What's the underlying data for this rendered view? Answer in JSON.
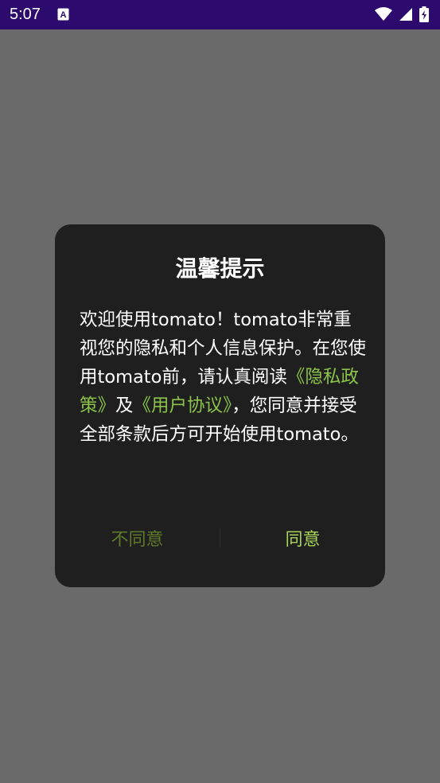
{
  "status_bar": {
    "time": "5:07",
    "notification_icon": "a-badge-icon",
    "icons": [
      "wifi-icon",
      "signal-icon",
      "battery-charging-icon"
    ],
    "bg_color": "#2d0a6e"
  },
  "dialog": {
    "title": "温馨提示",
    "body": {
      "part1": "欢迎使用tomato！tomato非常重视您的隐私和个人信息保护。在您使用tomato前，请认真阅读",
      "privacy_link": "《隐私政策》",
      "and": "及",
      "terms_link": "《用户协议》",
      "part2": "，您同意并接受全部条款后方可开始使用tomato。"
    },
    "disagree_label": "不同意",
    "agree_label": "同意",
    "accent_color": "#8bc34a"
  }
}
